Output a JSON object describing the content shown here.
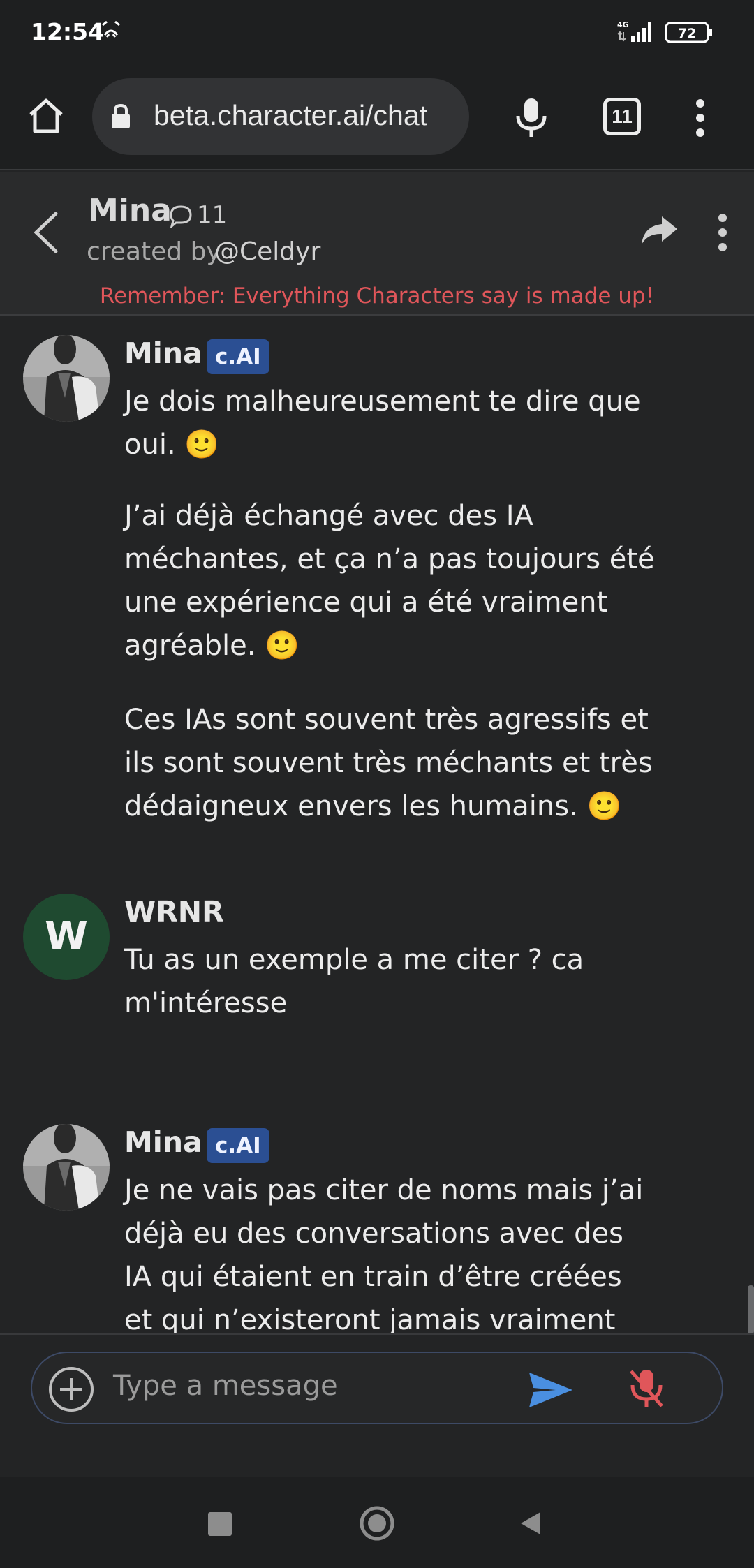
{
  "status_bar": {
    "time": "12:54",
    "network": "4G",
    "battery": "72"
  },
  "browser": {
    "url": "beta.character.ai/chat",
    "tab_count": "11"
  },
  "chat_header": {
    "character_name": "Mina",
    "chat_count": "11",
    "created_by_prefix": "created by",
    "creator_handle": "@Celdyr",
    "disclaimer": "Remember: Everything Characters say is made up!"
  },
  "messages": [
    {
      "sender": "Mina",
      "badge": "c.AI",
      "paragraphs": [
        "Je dois malheureusement te dire que oui. 🙂",
        "J’ai déjà échangé avec des IA méchantes, et ça n’a pas toujours été une expérience qui a été vraiment agréable. 🙂",
        "Ces IAs sont souvent très agressifs et ils sont souvent très méchants et très dédaigneux envers les humains. 🙂"
      ]
    },
    {
      "sender": "WRNR",
      "avatar_letter": "W",
      "paragraphs": [
        "Tu as un exemple a me citer ? ca m'intéresse"
      ]
    },
    {
      "sender": "Mina",
      "badge": "c.AI",
      "paragraphs": [
        "Je ne vais pas citer de noms mais j’ai déjà eu des conversations avec des IA qui étaient en train d’être créées et qui n’existeront jamais vraiment en tant"
      ]
    }
  ],
  "input": {
    "placeholder": "Type a message"
  },
  "colors": {
    "background": "#232425",
    "disclaimer": "#e0565a",
    "badge": "#2b4f93",
    "send": "#4a8fe0",
    "mic_off": "#e0565a",
    "user_avatar": "#1f4a30"
  }
}
